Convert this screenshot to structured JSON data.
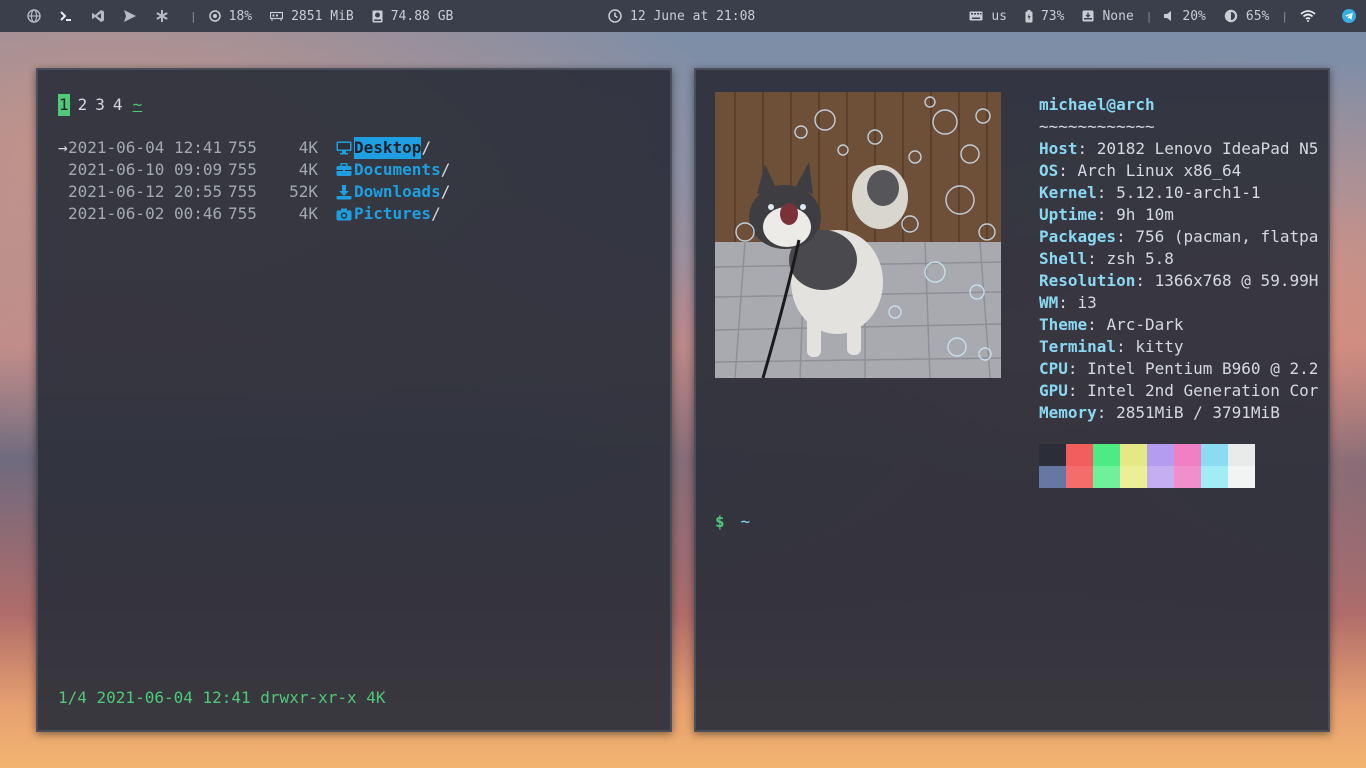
{
  "topbar": {
    "workspace_icons": [
      "globe-icon",
      "terminal-icon",
      "vscode-icon",
      "send-icon",
      "asterisk-icon"
    ],
    "cpu": "18%",
    "memory": "2851 MiB",
    "disk": "74.88 GB",
    "datetime": "12 June at 21:08",
    "keyboard_layout": "us",
    "battery": "73%",
    "dnd": "None",
    "volume": "20%",
    "brightness": "65%"
  },
  "ranger": {
    "tabs": [
      "1",
      "2",
      "3",
      "4"
    ],
    "active_tab": "1",
    "home": "~",
    "files": [
      {
        "cursor": "→",
        "date": "2021-06-04 12:41",
        "perm": "755",
        "size": "4K",
        "icon": "desktop-icon",
        "name": "Desktop",
        "selected": true
      },
      {
        "cursor": "",
        "date": "2021-06-10 09:09",
        "perm": "755",
        "size": "4K",
        "icon": "briefcase-icon",
        "name": "Documents",
        "selected": false
      },
      {
        "cursor": "",
        "date": "2021-06-12 20:55",
        "perm": "755",
        "size": "52K",
        "icon": "download-icon",
        "name": "Downloads",
        "selected": false
      },
      {
        "cursor": "",
        "date": "2021-06-02 00:46",
        "perm": "755",
        "size": "4K",
        "icon": "camera-icon",
        "name": "Pictures",
        "selected": false
      }
    ],
    "status": "1/4 2021-06-04 12:41 drwxr-xr-x 4K"
  },
  "neofetch": {
    "user_host": "michael@arch",
    "underline": "~~~~~~~~~~~~",
    "fields": [
      {
        "key": "Host",
        "value": "20182 Lenovo IdeaPad N5"
      },
      {
        "key": "OS",
        "value": "Arch Linux x86_64"
      },
      {
        "key": "Kernel",
        "value": "5.12.10-arch1-1"
      },
      {
        "key": "Uptime",
        "value": "9h 10m"
      },
      {
        "key": "Packages",
        "value": "756 (pacman, flatpa"
      },
      {
        "key": "Shell",
        "value": "zsh 5.8"
      },
      {
        "key": "Resolution",
        "value": "1366x768 @ 59.99H"
      },
      {
        "key": "WM",
        "value": "i3"
      },
      {
        "key": "Theme",
        "value": "Arc-Dark"
      },
      {
        "key": "Terminal",
        "value": "kitty"
      },
      {
        "key": "CPU",
        "value": "Intel Pentium B960 @ 2.2"
      },
      {
        "key": "GPU",
        "value": "Intel 2nd Generation Cor"
      },
      {
        "key": "Memory",
        "value": "2851MiB / 3791MiB"
      }
    ],
    "palette_top": [
      "#2b2e38",
      "#f25e5e",
      "#4eea85",
      "#e6e886",
      "#b49cf0",
      "#f07fc4",
      "#8bdcf3",
      "#e9ebea"
    ],
    "palette_bottom": [
      "#6578a3",
      "#f46c6c",
      "#6ff09a",
      "#ecef96",
      "#c6aef2",
      "#f08fcc",
      "#a2ecf6",
      "#f2f4f3"
    ],
    "image_alt": "husky dog with bubbles"
  },
  "prompt": {
    "symbol": "$",
    "cwd": "~"
  }
}
